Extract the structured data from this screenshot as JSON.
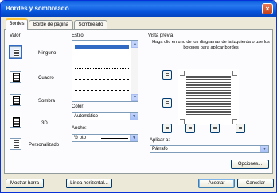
{
  "window": {
    "title": "Bordes y sombreado",
    "close": "×"
  },
  "tabs": [
    {
      "label": "Bordes"
    },
    {
      "label": "Borde de página"
    },
    {
      "label": "Sombreado"
    }
  ],
  "settings": {
    "heading": "Valor:",
    "items": [
      {
        "label": "Ninguno"
      },
      {
        "label": "Cuadro"
      },
      {
        "label": "Sombra"
      },
      {
        "label": "3D"
      },
      {
        "label": "Personalizado"
      }
    ]
  },
  "style": {
    "heading": "Estilo:"
  },
  "color": {
    "heading": "Color:",
    "value": "Automático"
  },
  "width": {
    "heading": "Ancho:",
    "value": "½ pto"
  },
  "preview": {
    "heading": "Vista previa",
    "instructions": "Haga clic en uno de los diagramas de la izquierda o use los botones para aplicar bordes"
  },
  "apply_to": {
    "heading": "Aplicar a:",
    "value": "Párrafo"
  },
  "buttons": {
    "options": "Opciones...",
    "show_toolbar": "Mostrar barra",
    "horizontal_line": "Línea horizontal...",
    "ok": "Aceptar",
    "cancel": "Cancelar"
  },
  "colors": {
    "titlebar": "#0a5ddc",
    "dialog": "#ece9d8",
    "selection": "#316ac5"
  }
}
